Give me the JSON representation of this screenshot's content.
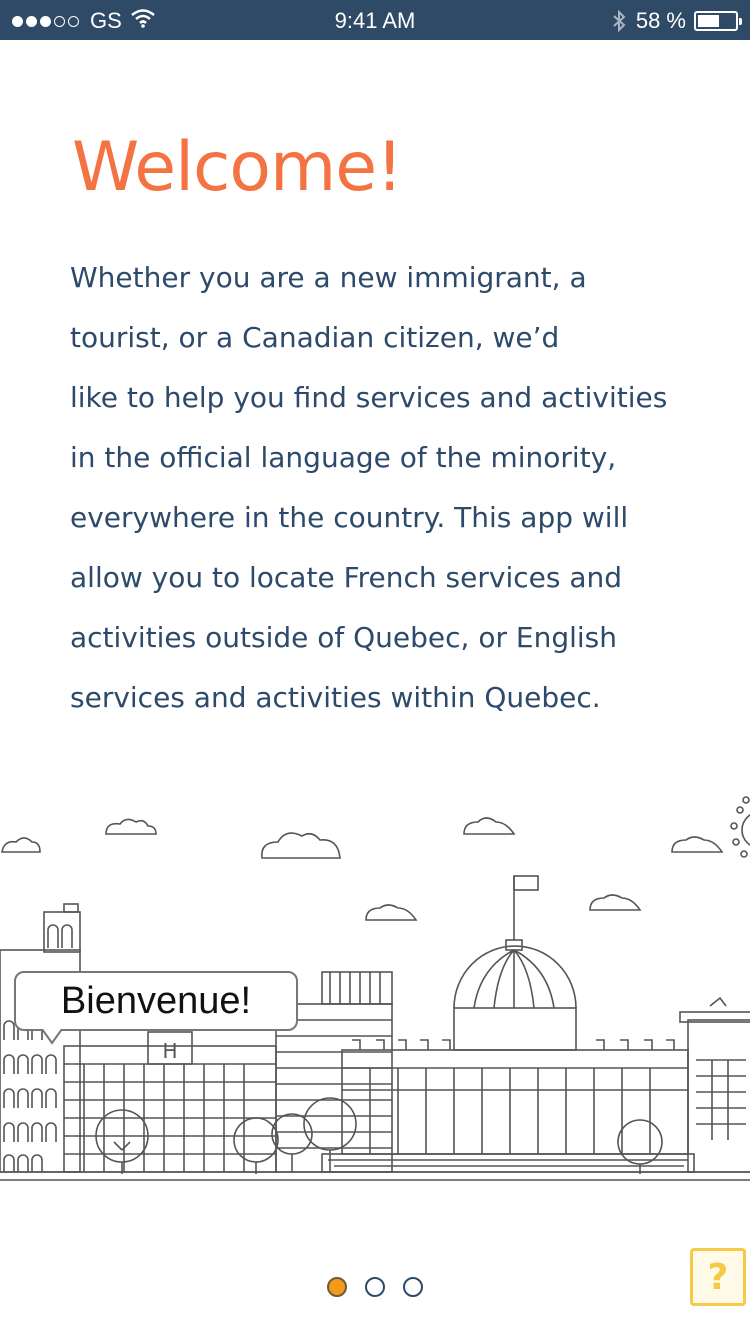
{
  "status_bar": {
    "carrier": "GS",
    "time": "9:41 AM",
    "battery_percent": "58 %",
    "battery_level": 0.58,
    "signal_bars_filled": 3,
    "signal_bars_total": 5,
    "icons": [
      "signal-dots-icon",
      "wifi-icon",
      "bluetooth-icon",
      "battery-icon"
    ]
  },
  "welcome": {
    "title": "Welcome!",
    "body_lines": [
      "Whether you are a new immigrant, a",
      "tourist, or a Canadian citizen, we’d",
      "like to help you find services and activities",
      "in the official language of the minority,",
      "everywhere in the country. This app will",
      "allow you to locate French services and",
      "activities outside of Quebec, or English",
      "services and activities within Quebec."
    ]
  },
  "illustration": {
    "bubble_text": "Bienvenue!",
    "hotel_sign": "H"
  },
  "pager": {
    "current_page": 1,
    "total_pages": 3
  },
  "help": {
    "glyph": "?",
    "icon": "help-icon"
  },
  "colors": {
    "status_bar": "#2f4a66",
    "title": "#f47342",
    "body": "#2e4a6b",
    "active_dot": "#f29b1a",
    "help": "#f7c948"
  }
}
